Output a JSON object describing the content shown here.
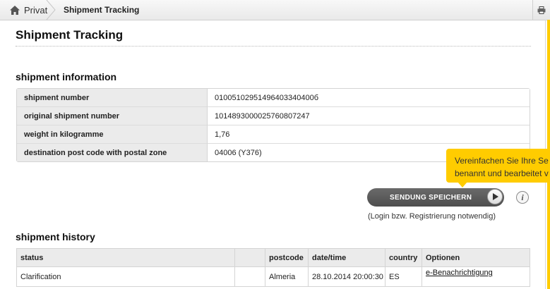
{
  "breadcrumb": {
    "home_label": "Privat",
    "current": "Shipment Tracking"
  },
  "page": {
    "title": "Shipment Tracking"
  },
  "info": {
    "heading": "shipment information",
    "rows": [
      {
        "label": "shipment number",
        "value": "01005102951496403340400б"
      },
      {
        "label": "original shipment number",
        "value": "1014893000025760807247"
      },
      {
        "label": "weight in kilogramme",
        "value": "1,76"
      },
      {
        "label": "destination post code with postal zone",
        "value": "04006 (Y376)"
      }
    ]
  },
  "tooltip": {
    "line1": "Vereinfachen Sie Ihre Se",
    "line2": "benannt und bearbeitet v"
  },
  "save": {
    "label": "SENDUNG SPEICHERN",
    "note": "(Login bzw. Registrierung notwendig)",
    "info_glyph": "i"
  },
  "history": {
    "heading": "shipment history",
    "columns": [
      "status",
      "",
      "postcode",
      "date/time",
      "country",
      "Optionen"
    ],
    "rows": [
      {
        "status": "Clarification",
        "blank": "",
        "postcode": "Almeria",
        "datetime": "28.10.2014 20:00:30",
        "country": "ES",
        "option": "e-Benachrichtigung"
      }
    ]
  },
  "colors": {
    "accent_yellow": "#ffcc00",
    "button_gray": "#5a5a5a"
  },
  "icons": [
    "home-icon",
    "print-icon",
    "play-icon",
    "info-icon"
  ]
}
